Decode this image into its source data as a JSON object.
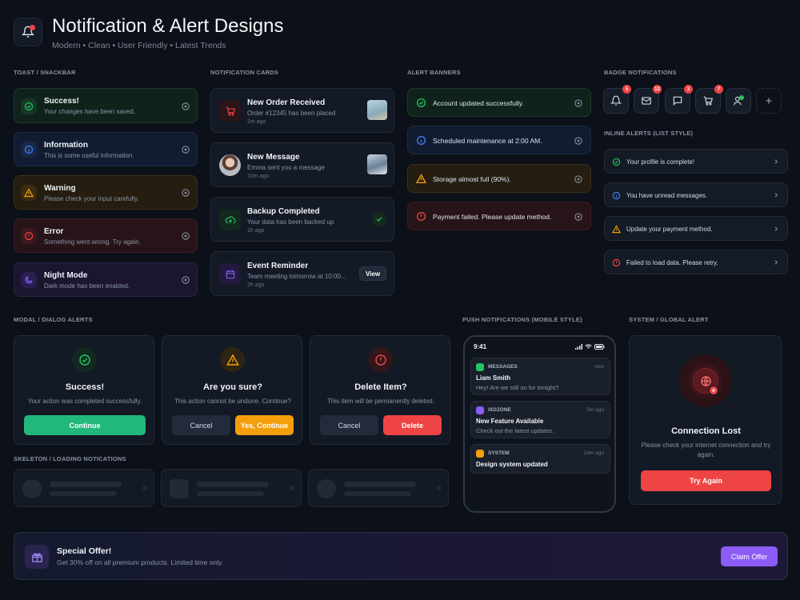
{
  "header": {
    "title": "Notification & Alert Designs",
    "subtitle": "Modern • Clean • User Friendly • Latest Trends",
    "icon": "bell-icon"
  },
  "sections": {
    "toast": "TOAST / SNACKBAR",
    "cards": "NOTIFICATION CARDS",
    "banners": "ALERT BANNERS",
    "badges": "BADGE NOTIFICATIONS",
    "inline": "INLINE ALERTS (LIST STYLE)",
    "modal": "MODAL / DIALOG ALERTS",
    "push": "PUSH NOTIFICATIONS (MOBILE STYLE)",
    "system": "SYSTEM / GLOBAL ALERT",
    "skeleton": "SKELETON / LOADING NOTICATIONS"
  },
  "toasts": [
    {
      "title": "Success!",
      "message": "Your changes have been saved.",
      "color": "#22c55e",
      "icon": "check-circle-icon"
    },
    {
      "title": "Information",
      "message": "This is some useful information.",
      "color": "#3b82f6",
      "icon": "info-icon"
    },
    {
      "title": "Warning",
      "message": "Please check your input carefully.",
      "color": "#f59e0b",
      "icon": "warning-icon"
    },
    {
      "title": "Error",
      "message": "Something went wrong. Try again.",
      "color": "#ef4444",
      "icon": "error-icon"
    },
    {
      "title": "Night Mode",
      "message": "Dark mode has been enabled.",
      "color": "#8b5cf6",
      "icon": "moon-icon"
    }
  ],
  "notification_cards": [
    {
      "title": "New Order Received",
      "message": "Order #12345 has been placed",
      "time": "2m ago",
      "icon": "cart-icon"
    },
    {
      "title": "New Message",
      "message": "Emma sent you a message",
      "time": "10m ago",
      "icon": "avatar"
    },
    {
      "title": "Backup Completed",
      "message": "Your data has been backed up",
      "time": "1h ago",
      "icon": "cloud-icon"
    },
    {
      "title": "Event Reminder",
      "message": "Team meeting tomorrow at 10:00...",
      "time": "2h ago",
      "icon": "calendar-icon",
      "action": "View"
    }
  ],
  "banners": [
    {
      "text": "Account updated successfully.",
      "color": "#22c55e"
    },
    {
      "text": "Scheduled maintenance at 2:00 AM.",
      "color": "#3b82f6"
    },
    {
      "text": "Storage almost full (90%).",
      "color": "#f59e0b"
    },
    {
      "text": "Payment failed. Please update method.",
      "color": "#ef4444"
    }
  ],
  "badges": [
    {
      "icon": "bell-icon",
      "count": "5"
    },
    {
      "icon": "mail-icon",
      "count": "12"
    },
    {
      "icon": "chat-icon",
      "count": "3"
    },
    {
      "icon": "cart-icon",
      "count": "7"
    },
    {
      "icon": "user-icon",
      "count": ""
    },
    {
      "icon": "plus-icon",
      "count": ""
    }
  ],
  "inline_alerts": [
    {
      "text": "Your profile is complete!",
      "color": "#22c55e"
    },
    {
      "text": "You have unread messages.",
      "color": "#3b82f6"
    },
    {
      "text": "Update your payment method.",
      "color": "#f59e0b"
    },
    {
      "text": "Failed to load data. Please retry.",
      "color": "#ef4444"
    }
  ],
  "modals": [
    {
      "title": "Success!",
      "message": "Your action was completed successfully.",
      "primary": "Continue",
      "color": "#22c55e"
    },
    {
      "title": "Are you sure?",
      "message": "This action cannot be undone. Continue?",
      "secondary": "Cancel",
      "primary": "Yes, Continue",
      "color": "#f59e0b"
    },
    {
      "title": "Delete Item?",
      "message": "This item will be permanently deleted.",
      "secondary": "Cancel",
      "primary": "Delete",
      "color": "#ef4444"
    }
  ],
  "phone": {
    "time": "9:41",
    "notifications": [
      {
        "app": "MESSAGES",
        "time": "now",
        "title": "Liam Smith",
        "message": "Hey! Are we still on for tonight?",
        "color": "#22c55e"
      },
      {
        "app": "IXDZONE",
        "time": "5m ago",
        "title": "New Feature Available",
        "message": "Check out the latest updates.",
        "color": "#8b5cf6"
      },
      {
        "app": "SYSTEM",
        "time": "10m ago",
        "title": "Design system updated",
        "message": "",
        "color": "#f59e0b"
      }
    ]
  },
  "system_alert": {
    "title": "Connection Lost",
    "message": "Please check your internet connection and try again.",
    "button": "Try Again"
  },
  "offer": {
    "title": "Special Offer!",
    "message": "Get 30% off on all premium products. Limited time only.",
    "button": "Claim Offer"
  }
}
